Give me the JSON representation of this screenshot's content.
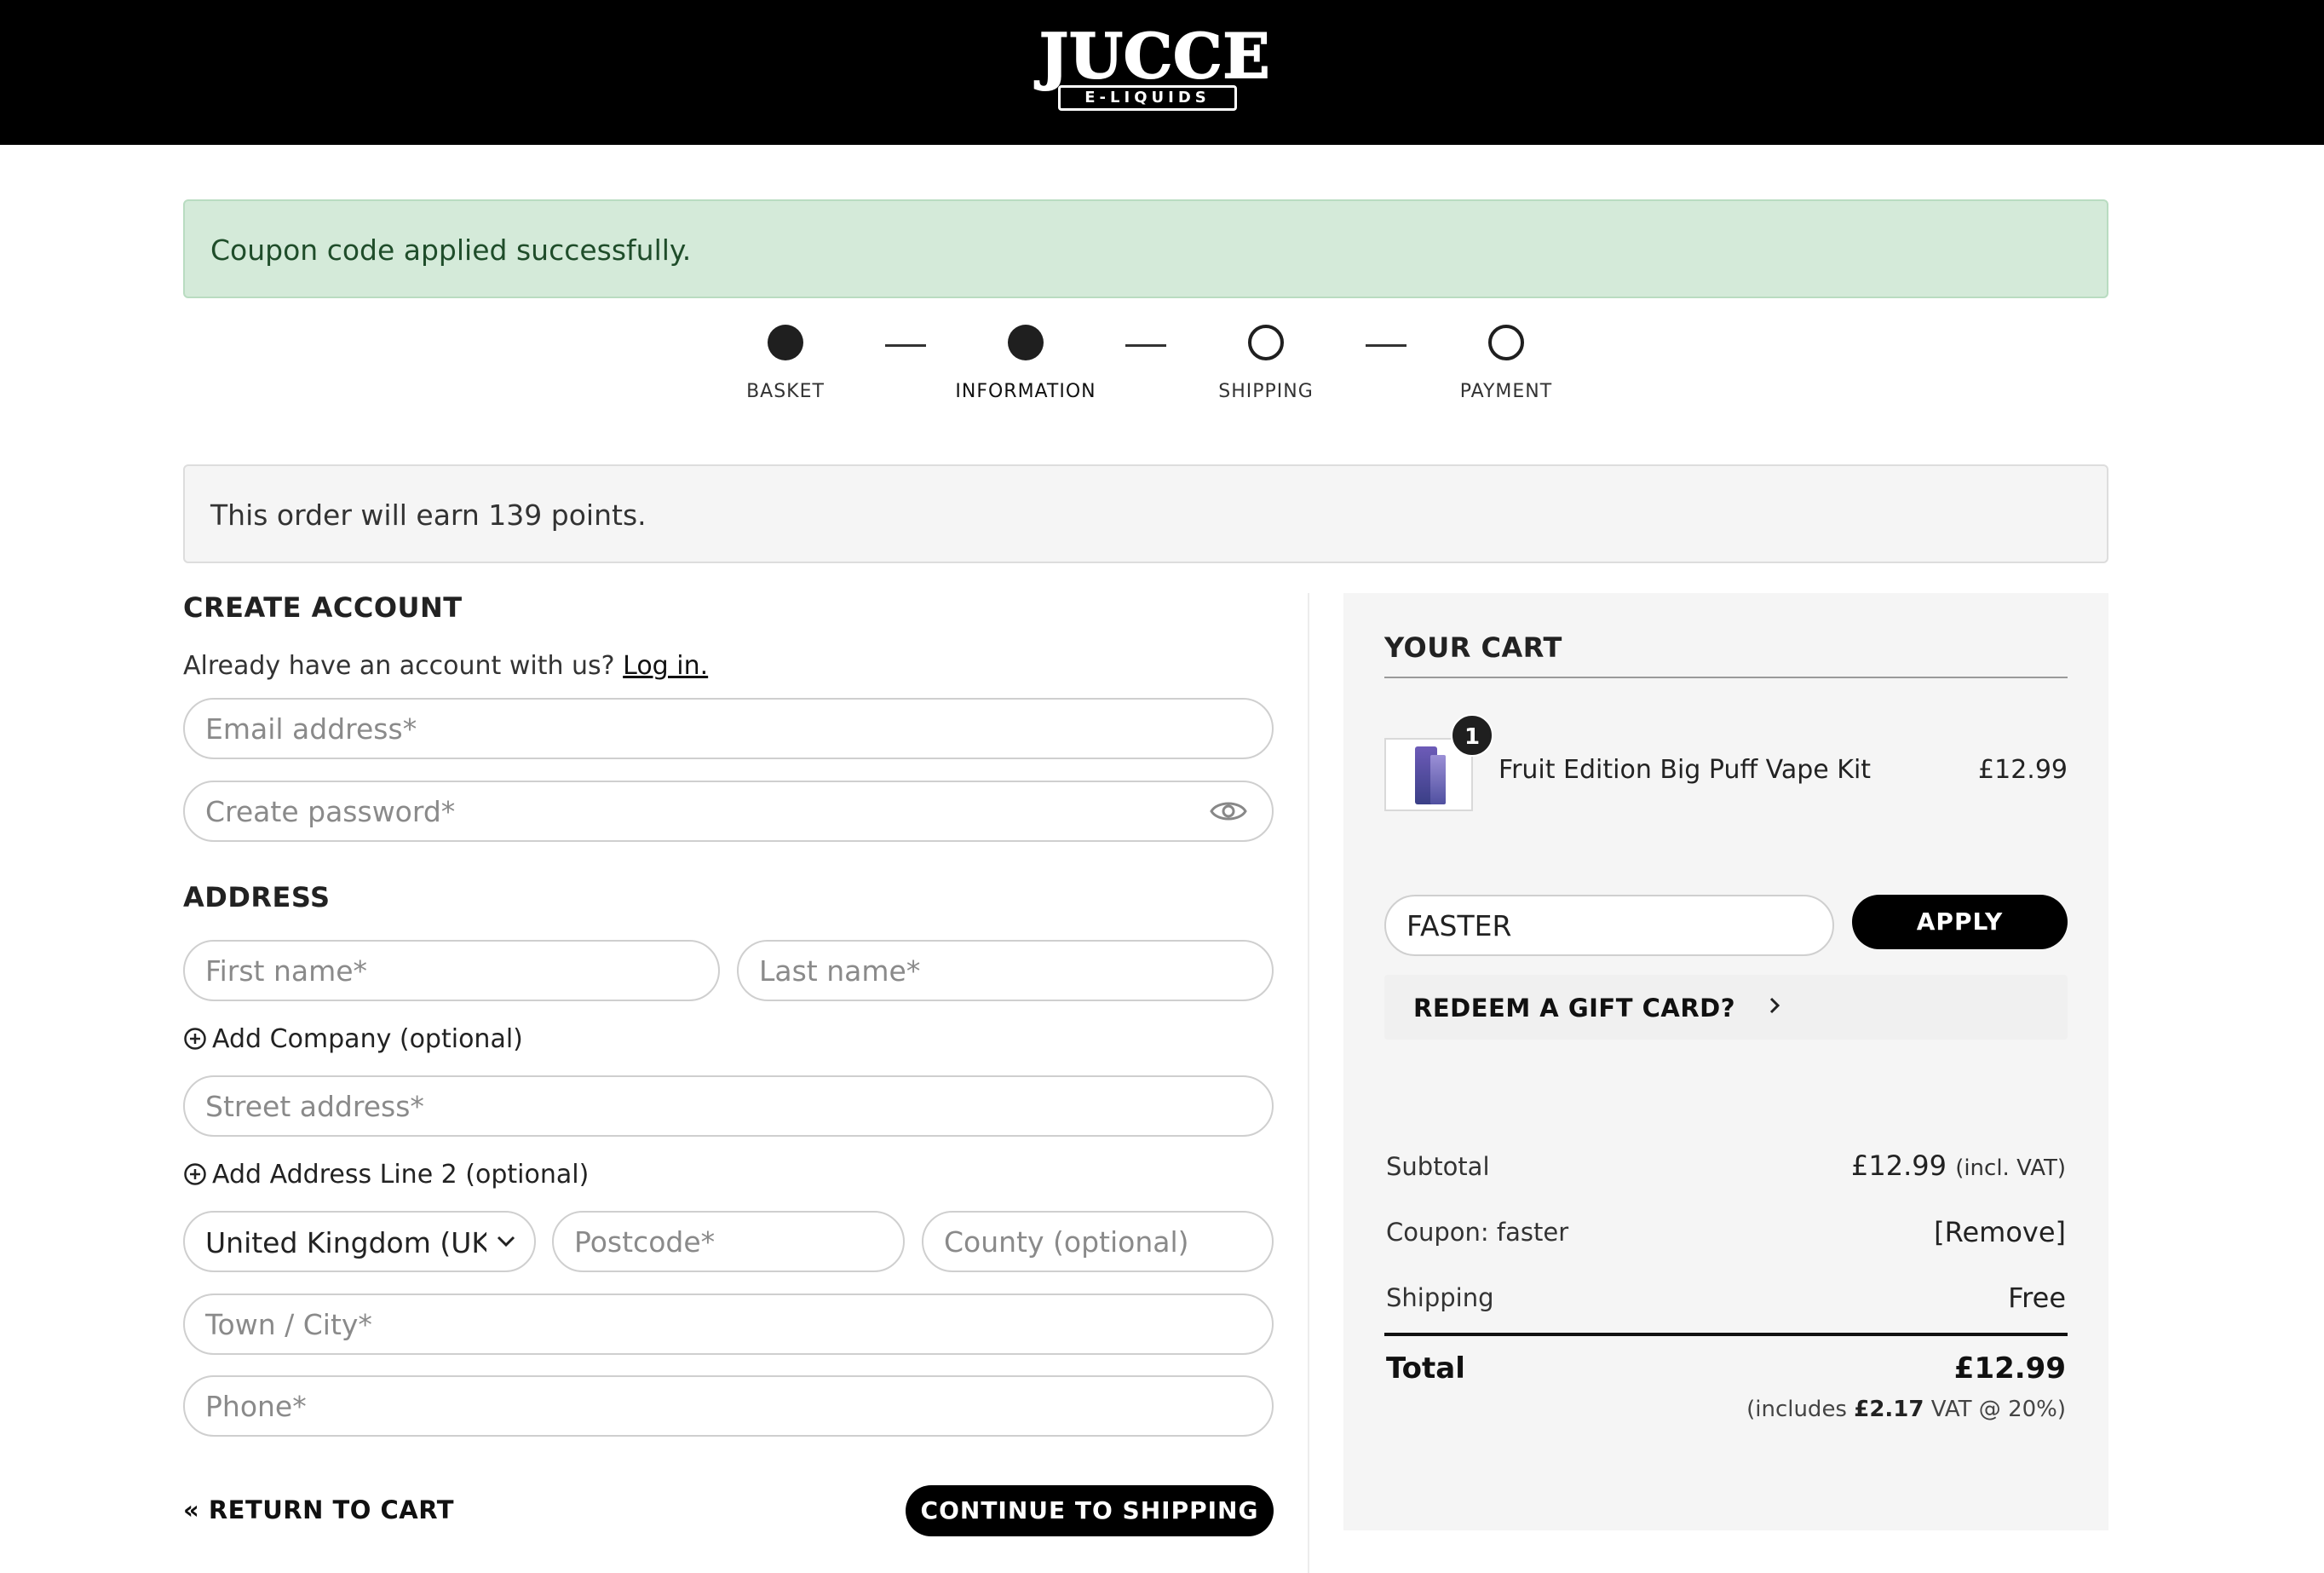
{
  "brand": {
    "logo_word": "JUCCE",
    "logo_sub": "E-LIQUIDS"
  },
  "alerts": {
    "success": "Coupon code applied successfully.",
    "points": "This order will earn 139 points."
  },
  "stepper": {
    "steps": [
      {
        "label": "BASKET",
        "state": "complete"
      },
      {
        "label": "INFORMATION",
        "state": "current"
      },
      {
        "label": "SHIPPING",
        "state": "pending"
      },
      {
        "label": "PAYMENT",
        "state": "pending"
      }
    ]
  },
  "account": {
    "heading": "CREATE ACCOUNT",
    "prompt": "Already have an account with us?",
    "login_link": "Log in.",
    "email_placeholder": "Email address*",
    "password_placeholder": "Create password*"
  },
  "address": {
    "heading": "ADDRESS",
    "first_name_placeholder": "First name*",
    "last_name_placeholder": "Last name*",
    "add_company": "Add Company (optional)",
    "street_placeholder": "Street address*",
    "add_line2": "Add Address Line 2 (optional)",
    "country_value": "United Kingdom (UK)",
    "postcode_placeholder": "Postcode*",
    "county_placeholder": "County (optional)",
    "town_placeholder": "Town / City*",
    "phone_placeholder": "Phone*"
  },
  "actions": {
    "return_label": "« RETURN TO CART",
    "continue_label": "CONTINUE TO SHIPPING"
  },
  "cart": {
    "title": "YOUR CART",
    "items": [
      {
        "name": "Fruit Edition Big Puff Vape Kit",
        "price": "£12.99",
        "quantity": "1"
      }
    ],
    "coupon_value": "FASTER",
    "apply_label": "APPLY",
    "redeem_label": "REDEEM A GIFT CARD?",
    "summary": {
      "subtotal_label": "Subtotal",
      "subtotal_value": "£12.99",
      "subtotal_note": "(incl. VAT)",
      "coupon_label": "Coupon: faster",
      "coupon_remove": "[Remove]",
      "shipping_label": "Shipping",
      "shipping_value": "Free",
      "total_label": "Total",
      "total_value": "£12.99",
      "vat_prefix": "(includes",
      "vat_amount": "£2.17",
      "vat_suffix": "VAT @ 20%)"
    }
  }
}
